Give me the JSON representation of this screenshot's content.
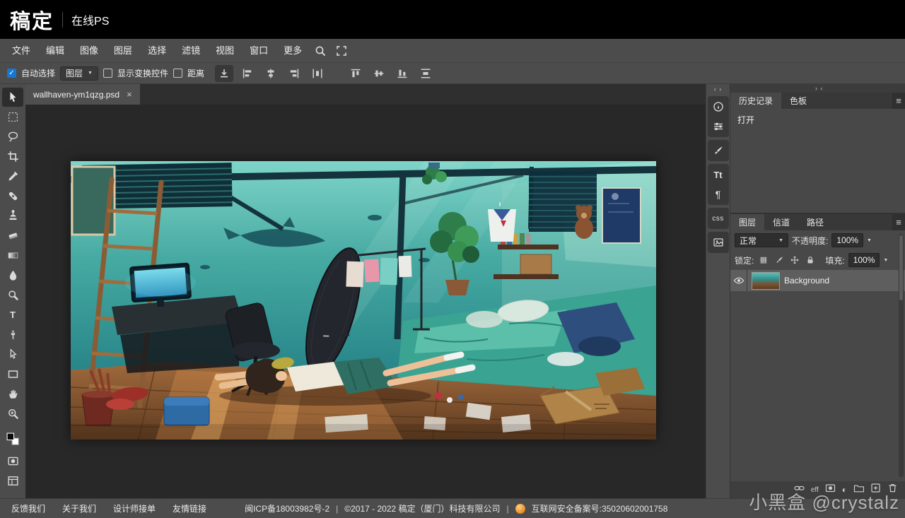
{
  "header": {
    "logo": "稿定",
    "subtitle": "在线PS"
  },
  "menubar": {
    "items": [
      "文件",
      "编辑",
      "图像",
      "图层",
      "选择",
      "滤镜",
      "视图",
      "窗口",
      "更多"
    ]
  },
  "optionsbar": {
    "auto_select_label": "自动选择",
    "target_value": "图层",
    "show_transform_label": "显示变换控件",
    "distance_label": "距离"
  },
  "tabbar": {
    "tabs": [
      {
        "label": "wallhaven-ym1qzg.psd"
      }
    ]
  },
  "rail": {
    "tt": "Tt",
    "para": "¶",
    "css": "css"
  },
  "history_panel": {
    "tabs": [
      "历史记录",
      "色板"
    ],
    "entries": [
      "打开"
    ]
  },
  "layers_panel": {
    "tabs": [
      "图层",
      "信道",
      "路径"
    ],
    "blend_mode": "正常",
    "opacity_label": "不透明度:",
    "opacity_value": "100%",
    "lock_label": "锁定:",
    "fill_label": "填充:",
    "fill_value": "100%",
    "layers": [
      {
        "name": "Background"
      }
    ],
    "eff_label": "eff"
  },
  "footer": {
    "links": [
      "反馈我们",
      "关于我们",
      "设计师接单",
      "友情链接"
    ],
    "icp": "闽ICP备18003982号-2",
    "sep": "|",
    "copyright": "©2017 - 2022 稿定（厦门）科技有限公司",
    "security": "互联网安全备案号:35020602001758"
  },
  "watermark": "小黑盒 @crystalz",
  "icons": {
    "check": "✓",
    "close": "×",
    "menu": "≡",
    "caret": "▼",
    "collapse_l": "‹ ›",
    "collapse_r": "› ‹",
    "half": "◐",
    "checker": "▦",
    "t": "T"
  },
  "colors": {
    "accent_blue": "#1577d1",
    "panel_bg": "#484848",
    "canvas_bg": "#282828",
    "topbar_bg": "#000000"
  }
}
